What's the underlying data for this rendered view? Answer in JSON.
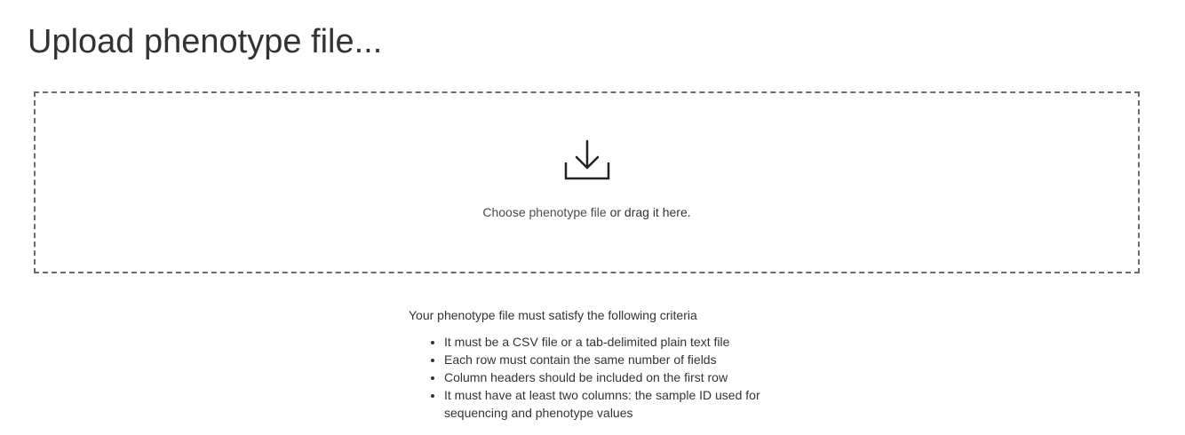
{
  "page": {
    "title": "Upload phenotype file..."
  },
  "dropzone": {
    "icon": "download-icon",
    "choose_link": "Choose phenotype file",
    "drag_text": " or drag it here."
  },
  "criteria": {
    "title": "Your phenotype file must satisfy the following criteria",
    "items": [
      "It must be a CSV file or a tab-delimited plain text file",
      "Each row must contain the same number of fields",
      "Column headers should be included on the first row",
      "It must have at least two columns: the sample ID used for sequencing and phenotype values"
    ]
  },
  "colors": {
    "text": "#333333",
    "border": "#6b6b6b",
    "background": "#ffffff"
  }
}
